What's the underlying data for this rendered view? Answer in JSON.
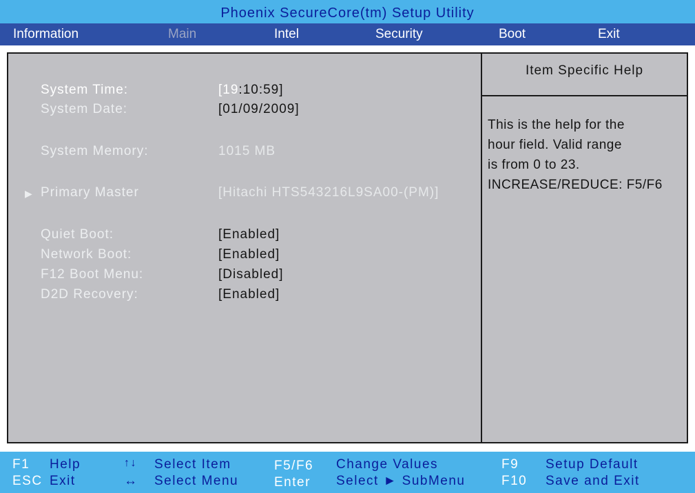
{
  "title": "Phoenix SecureCore(tm) Setup Utility",
  "menu": {
    "tabs": [
      "Information",
      "Main",
      "Intel",
      "Security",
      "Boot",
      "Exit"
    ],
    "active": "Main"
  },
  "main": {
    "system_time": {
      "label": "System Time:",
      "value_bracket_open": "[",
      "value_hour": "19",
      "value_rest": ":10:59]"
    },
    "system_date": {
      "label": "System Date:",
      "value": "[01/09/2009]"
    },
    "system_memory": {
      "label": "System Memory:",
      "value": "1015 MB"
    },
    "primary_master": {
      "label": "Primary Master",
      "value": "[Hitachi HTS543216L9SA00-(PM)]"
    },
    "quiet_boot": {
      "label": "Quiet Boot:",
      "value": "[Enabled]"
    },
    "network_boot": {
      "label": "Network Boot:",
      "value": "[Enabled]"
    },
    "f12_boot_menu": {
      "label": "F12 Boot Menu:",
      "value": "[Disabled]"
    },
    "d2d_recovery": {
      "label": "D2D Recovery:",
      "value": "[Enabled]"
    }
  },
  "help": {
    "title": "Item Specific Help",
    "lines": [
      "This is the help for the",
      "hour field. Valid range",
      "is from 0 to 23.",
      "INCREASE/REDUCE: F5/F6"
    ]
  },
  "footer": {
    "f1_key": "F1",
    "f1_desc": "Help",
    "esc_key": "ESC",
    "esc_desc": "Exit",
    "updown_symbol": "↑↓",
    "updown_desc": "Select  Item",
    "leftright_symbol": "↔",
    "leftright_desc": "Select  Menu",
    "f5f6_key": "F5/F6",
    "f5f6_desc": "Change  Values",
    "enter_key": "Enter",
    "enter_desc": "Select  ► SubMenu",
    "f9_key": "F9",
    "f9_desc": "Setup  Default",
    "f10_key": "F10",
    "f10_desc": "Save  and  Exit"
  },
  "colors": {
    "title_bg": "#4bb3ea",
    "menu_bg": "#2e50a6",
    "panel_bg": "#c0c0c4",
    "footer_text": "#0a1d9b"
  }
}
